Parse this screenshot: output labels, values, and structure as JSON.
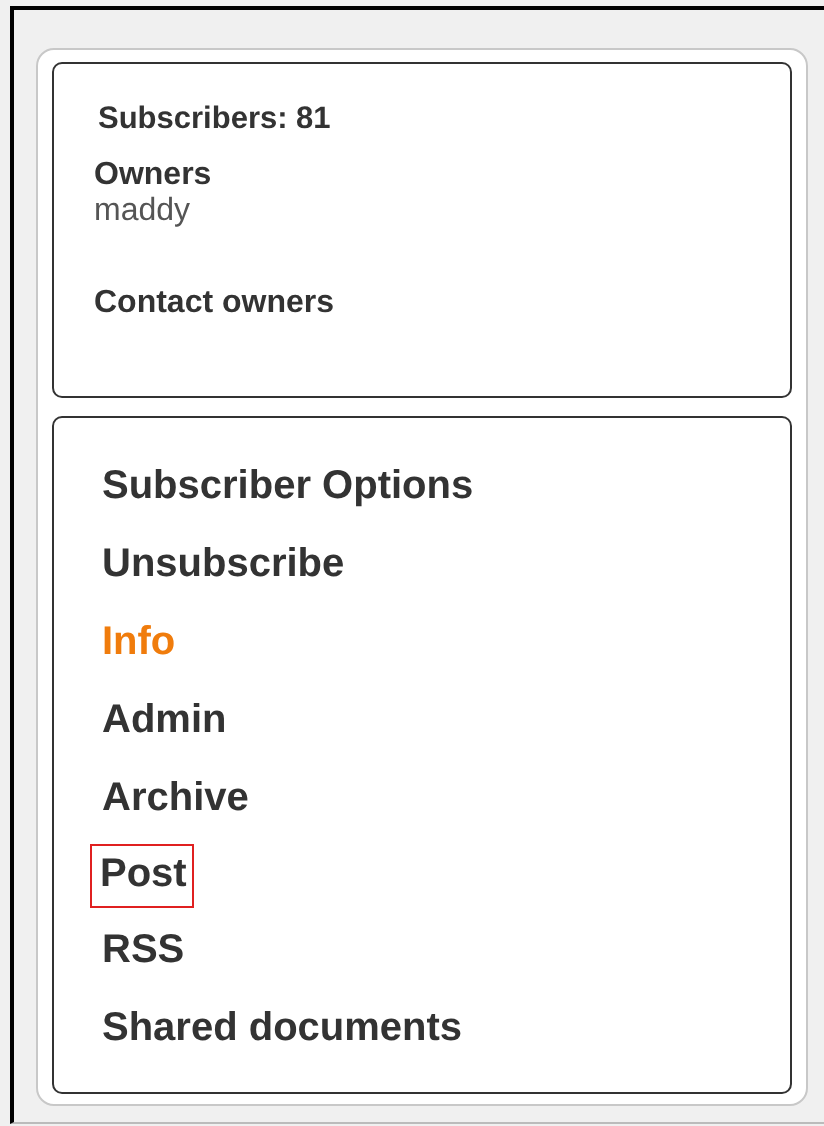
{
  "summary": {
    "subscribers": "Subscribers: 81",
    "owners_label": "Owners",
    "owners": [
      "maddy"
    ],
    "contact": "Contact owners"
  },
  "menu": [
    {
      "label": "Subscriber Options",
      "selected": false,
      "highlighted": false
    },
    {
      "label": "Unsubscribe",
      "selected": false,
      "highlighted": false
    },
    {
      "label": "Info",
      "selected": true,
      "highlighted": false
    },
    {
      "label": "Admin",
      "selected": false,
      "highlighted": false
    },
    {
      "label": "Archive",
      "selected": false,
      "highlighted": false
    },
    {
      "label": "Post",
      "selected": false,
      "highlighted": true
    },
    {
      "label": "RSS",
      "selected": false,
      "highlighted": false
    },
    {
      "label": "Shared documents",
      "selected": false,
      "highlighted": false
    }
  ]
}
